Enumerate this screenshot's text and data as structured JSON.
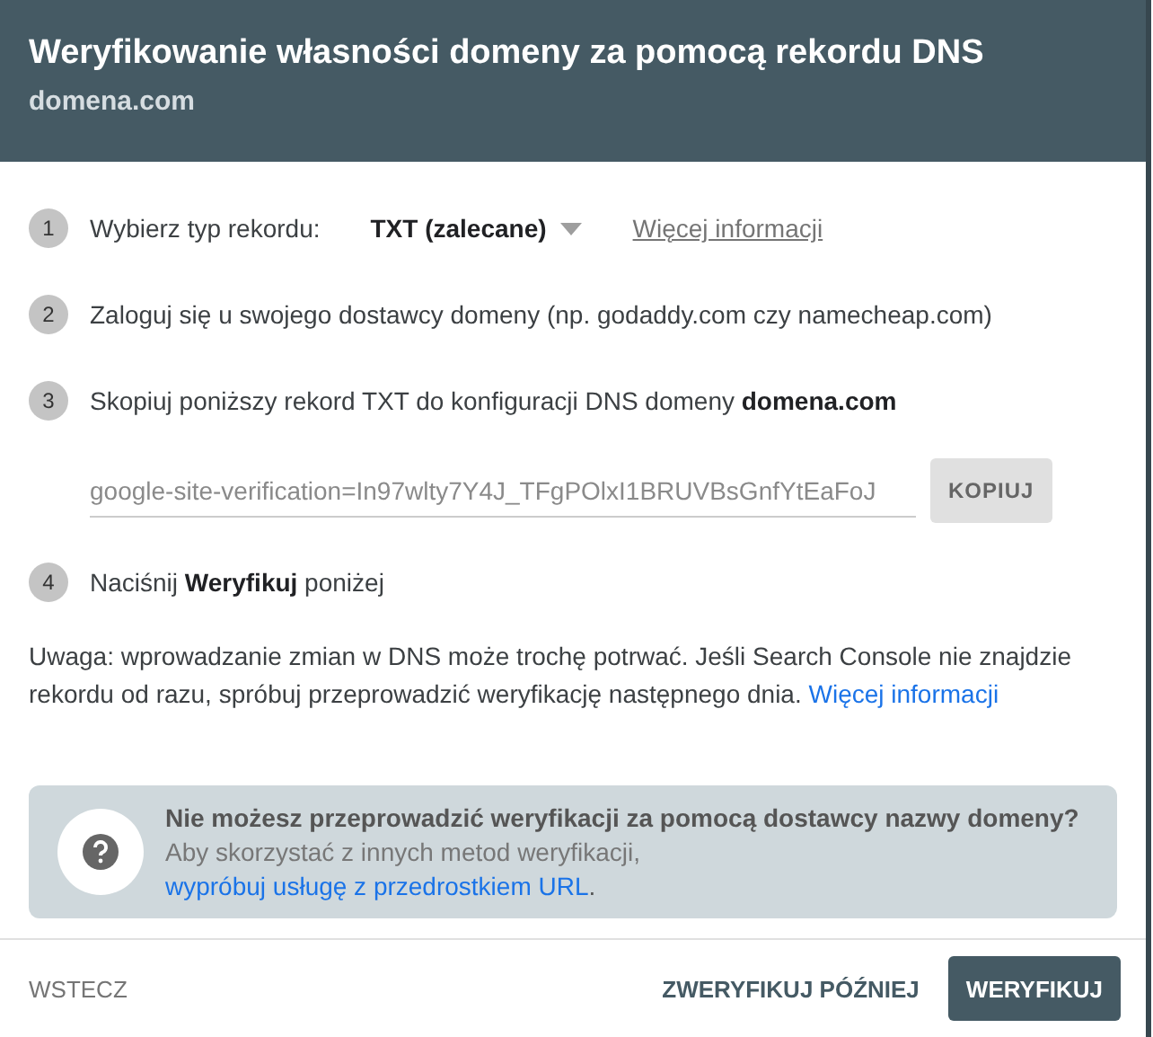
{
  "dialog": {
    "title": "Weryfikowanie własności domeny za pomocą rekordu DNS",
    "subtitle": "domena.com"
  },
  "steps": [
    {
      "number": "1",
      "kind": "select",
      "label": "Wybierz typ rekordu:",
      "value": "TXT (zalecane)",
      "link": "Więcej informacji"
    },
    {
      "number": "2",
      "kind": "text",
      "text": "Zaloguj się u swojego dostawcy domeny (np. godaddy.com czy namecheap.com)"
    },
    {
      "number": "3",
      "kind": "record",
      "text": "Skopiuj poniższy rekord TXT do konfiguracji DNS domeny **domena.com**",
      "value": "google-site-verification=In97wlty7Y4J_TFgPOlxI1BRUVBsGnfYtEaFoJ",
      "button": "KOPIUJ"
    },
    {
      "number": "4",
      "kind": "text",
      "text": "Naciśnij **Weryfikuj** poniżej"
    }
  ],
  "note": {
    "text": "Uwaga: wprowadzanie zmian w DNS może trochę potrwać. Jeśli Search Console nie znajdzie rekordu od razu, spróbuj przeprowadzić weryfikację następnego dnia.",
    "link": "Więcej informacji"
  },
  "help": {
    "title": "Nie możesz przeprowadzić weryfikacji za pomocą dostawcy nazwy domeny?",
    "text": "Aby skorzystać z innych metod weryfikacji,",
    "link": "wypróbuj usługę z przedrostkiem URL",
    "suffix": "."
  },
  "footer": {
    "back": "WSTECZ",
    "later": "ZWERYFIKUJ PÓŹNIEJ",
    "verify": "WERYFIKUJ"
  }
}
